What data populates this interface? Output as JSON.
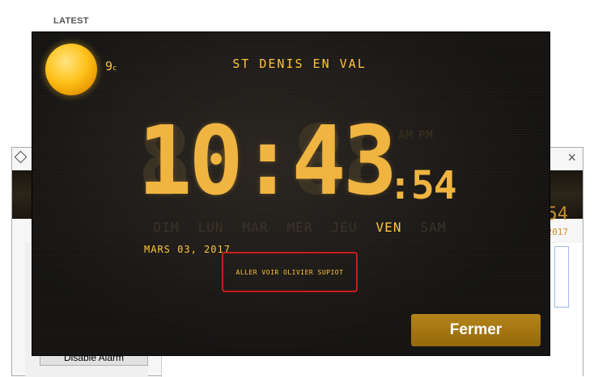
{
  "section_label": "LATEST",
  "weather": {
    "temperature": "9",
    "unit": "c",
    "icon": "sun-icon"
  },
  "location": "ST DENIS EN VAL",
  "clock": {
    "ampm_options": [
      "AM",
      "PM"
    ],
    "hours": "10",
    "minutes": "43",
    "seconds": "54",
    "ghost_hours": "88",
    "ghost_minutes": "88"
  },
  "days": [
    "DIM",
    "LUN",
    "MAR",
    "MER",
    "JEU",
    "VEN",
    "SAM"
  ],
  "active_day": "VEN",
  "date": "MARS 03, 2017",
  "alarm_message": "ALLER VOIR OLIVIER SUPIOT",
  "close_button": "Fermer",
  "background_window": {
    "peek_time": "54",
    "peek_date": "2017",
    "buttons": [
      "",
      "",
      "",
      "",
      "Disable Alarm"
    ]
  },
  "colors": {
    "accent": "#ffc43a",
    "digit": "#f0b540",
    "button": "#a8780f",
    "alarm_border": "#cc1c1c"
  }
}
